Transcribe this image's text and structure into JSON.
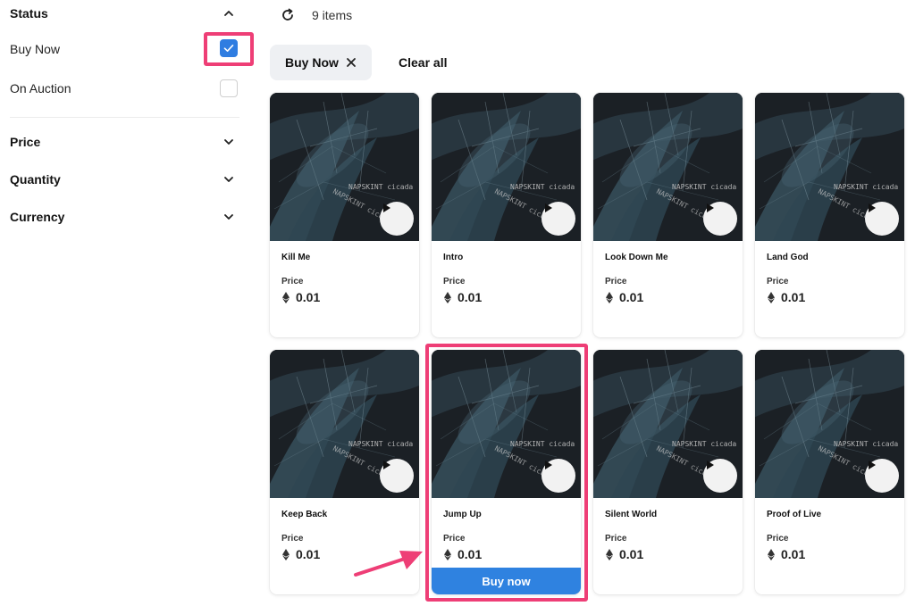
{
  "sidebar": {
    "status_title": "Status",
    "options": [
      {
        "label": "Buy Now",
        "checked": true
      },
      {
        "label": "On Auction",
        "checked": false
      }
    ],
    "filters": [
      {
        "label": "Price"
      },
      {
        "label": "Quantity"
      },
      {
        "label": "Currency"
      }
    ]
  },
  "toolbar": {
    "refresh_icon": "refresh-icon",
    "items_count": "9 items",
    "active_chip": "Buy Now",
    "clear_all": "Clear all"
  },
  "cards": [
    {
      "title": "Kill Me",
      "price_label": "Price",
      "price": "0.01"
    },
    {
      "title": "Intro",
      "price_label": "Price",
      "price": "0.01"
    },
    {
      "title": "Look Down Me",
      "price_label": "Price",
      "price": "0.01"
    },
    {
      "title": "Land God",
      "price_label": "Price",
      "price": "0.01"
    },
    {
      "title": "Keep Back",
      "price_label": "Price",
      "price": "0.01"
    },
    {
      "title": "Jump Up",
      "price_label": "Price",
      "price": "0.01",
      "buy_label": "Buy now"
    },
    {
      "title": "Silent World",
      "price_label": "Price",
      "price": "0.01"
    },
    {
      "title": "Proof of Live",
      "price_label": "Price",
      "price": "0.01"
    }
  ],
  "art_text": "NAPSKINT cicada",
  "colors": {
    "accent": "#2f82e0",
    "highlight": "#ee3e76",
    "chip_bg": "#eef0f3"
  }
}
